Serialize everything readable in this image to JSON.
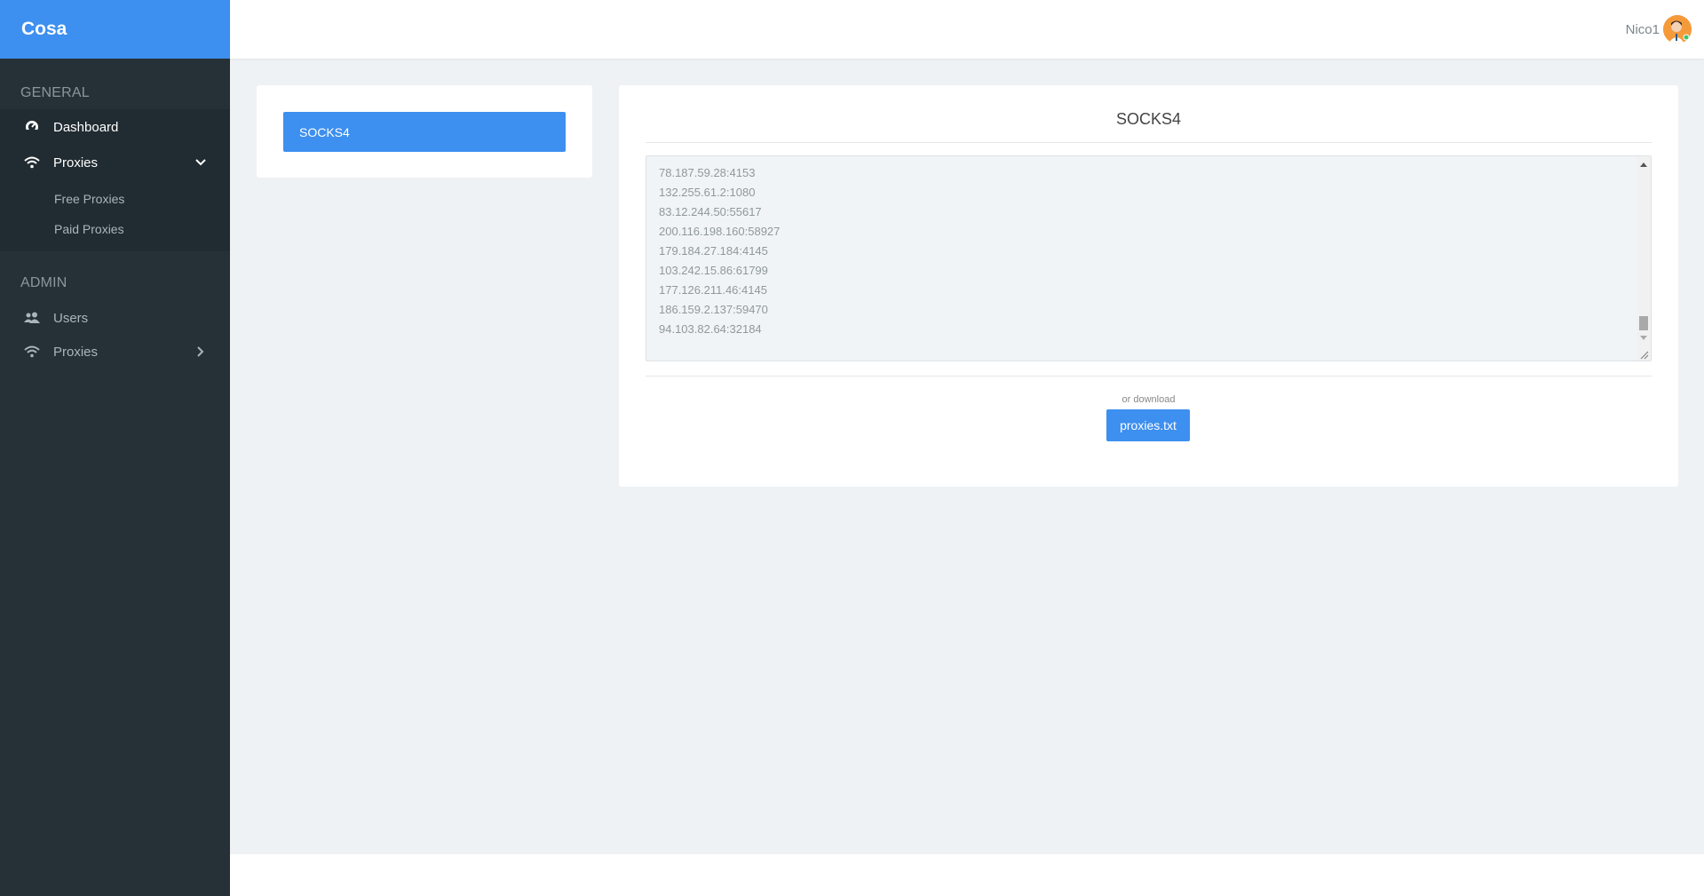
{
  "app": {
    "brand": "Cosa"
  },
  "sidebar": {
    "general_title": "GENERAL",
    "admin_title": "ADMIN",
    "general_items": [
      {
        "label": "Dashboard",
        "icon": "dashboard-icon"
      },
      {
        "label": "Proxies",
        "icon": "wifi-icon",
        "expanded": true
      }
    ],
    "proxies_sub": [
      {
        "label": "Free Proxies"
      },
      {
        "label": "Paid Proxies"
      }
    ],
    "admin_items": [
      {
        "label": "Users",
        "icon": "users-icon"
      },
      {
        "label": "Proxies",
        "icon": "wifi-icon",
        "expanded": false
      }
    ]
  },
  "header": {
    "username": "Nico1"
  },
  "proxy_types": [
    {
      "label": "SOCKS4"
    }
  ],
  "main": {
    "title": "SOCKS4",
    "proxies": [
      "78.187.59.28:4153",
      "132.255.61.2:1080",
      "83.12.244.50:55617",
      "200.116.198.160:58927",
      "179.184.27.184:4145",
      "103.242.15.86:61799",
      "177.126.211.46:4145",
      "186.159.2.137:59470",
      "94.103.82.64:32184"
    ],
    "or_download": "or download",
    "download_label": "proxies.txt"
  },
  "colors": {
    "accent": "#3d8ff0",
    "sidebar_bg": "#253137",
    "page_bg": "#eef2f4"
  }
}
